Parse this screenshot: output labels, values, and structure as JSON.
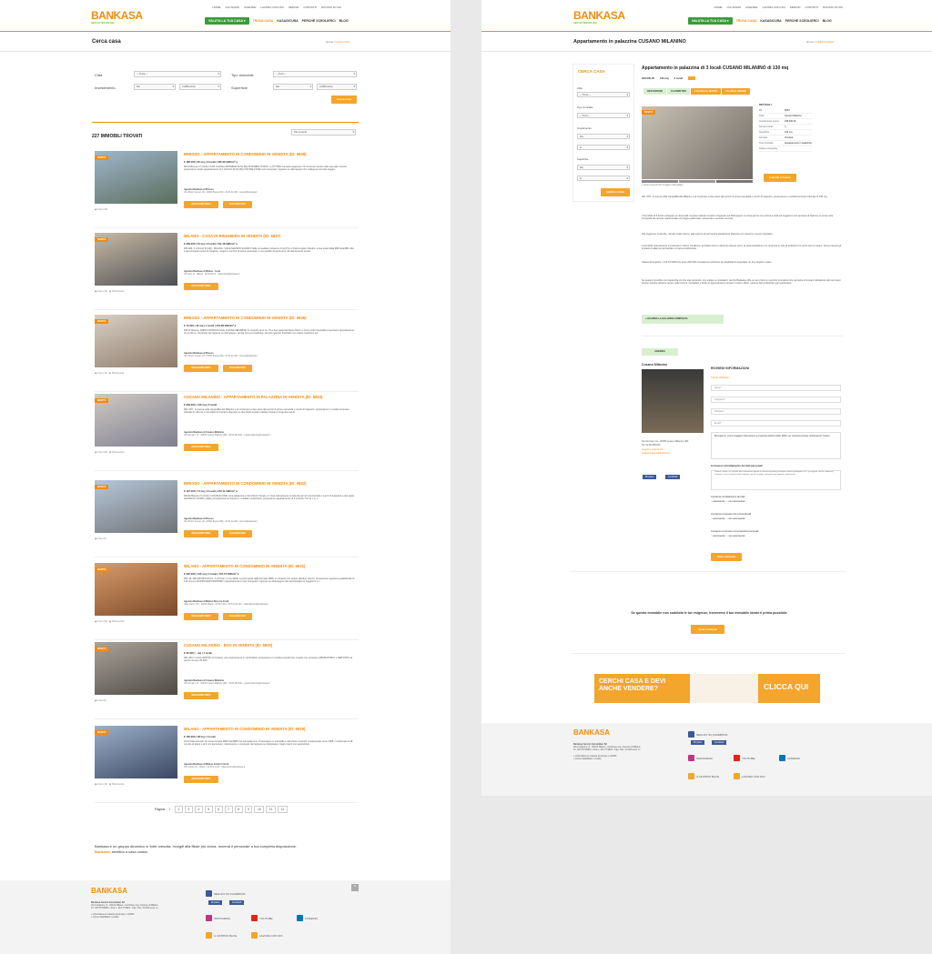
{
  "left": {
    "topnav": [
      "HOME",
      "CHI SIAMO",
      "AGENZIE",
      "LAVORA CON NOI",
      "SERVIZI",
      "CONTATTI",
      "DICONO DI NOI"
    ],
    "logo": {
      "text": "BANKASA",
      "sub": "SERVIZI IMMOBILIARI"
    },
    "mainnav": {
      "valuta": "VALUTA LA TUA CASA ▾",
      "trova": "TROVA CASA",
      "kasa": "KASASICURA",
      "perche": "PERCHÈ SCEGLIERCI",
      "blog": "BLOG"
    },
    "title": "Cerca casa",
    "breadcrumb": {
      "home": "Home",
      "sep": "/",
      "current": "Cerca casa"
    },
    "form": {
      "citta_label": "Città",
      "citta_value": "-- Tutte --",
      "tipo_label": "Tipo immobile",
      "tipo_value": "-- Tutti --",
      "inv_label": "Investimento",
      "inv_da": "Da",
      "inv_a": "indifferente",
      "sup_label": "Superficie",
      "sup_da": "Da",
      "sup_a": "indifferente",
      "button": "Cerca casa"
    },
    "count": "227 IMMOBILI TROVATI",
    "sort": "Più recenti",
    "badge": "NOVITÀ",
    "btn_info": "MAGGIORI INFO",
    "btn_kasa": "KASASICURA",
    "listings": [
      {
        "title": "BRESSO - APPARTAMENTO IN CONDOMINIO IN VENDITA (ID: 6838)",
        "meta": "€ 185.000 | 62 mq | 2 locali | 295,26 kWh/m² a",
        "desc": "Rif.24 Bresso 2 LOCALI CON CUCINA ABITABILE DI 62 MQ POSSIBILITÀ BOX. In OTTIMO contesto degli anni 70' circa ben tenuto nelle sue parti comuni, proponiamo ampio appartamento di 2 LOCALI DI 62 MQ CON BALCONE così composto: ingresso su disimpegno che collega al comodo soggio...",
        "agency": "Agenzia Bankasa di Bresso",
        "addr": "Via Vittorio Veneto, 29 - 20091 Bresso (MI) - 02.61.42.284 - bresso@bankasa.it",
        "foto": "Foto (13)",
        "kasa": true
      },
      {
        "title": "MILANO - CASA DI RINGHIERA IN VENDITA (ID: 6837)",
        "meta": "€ 269.000 | 54 mq | 2 locali | 511,48 kWh/m² a",
        "desc": "RIF.11B- 2 LOCALI 54 MQ - MILANO, VIALE MAZZINI SALMILT Nelle immediate vicinanze di via Prix e Piazza Appio Claudio, a due passi dalla MM Zara/MM Lilla e dai principali mezzi di trasporto, negozi e comfort di prima necessità, in uno stabile d'epoca anni '40 ottimamente tenuto.",
        "agency": "Agenzia Bankasa di Milano - Isola",
        "addr": "Via Lario 11 - Milano - 02.66.30.01 - milanoisola@bankasa.it",
        "foto": "Foto (14)",
        "plan": "Planimetria",
        "kasa": false
      },
      {
        "title": "BRESSO - APPARTAMENTO IN CONDOMINIO IN VENDITA (ID: 6836)",
        "meta": "€ 73.000 | 42 mq | 1 locali | 231,86 kWh/m² a",
        "desc": "RIF.57 Bresso, AMPIO MONOLOCALE CUCINA ABITABILE In contesto anni ca. 70 a due passi dal Parco Nord, in zona molto tranquilla proponiamo appartamento di mq 42 ca. composto da ingresso su disimpegno, ampia zona cucina/living, servizio igienico finestrato con vasca, locazione ed",
        "agency": "Agenzia Bankasa di Bresso",
        "addr": "Via Vittorio Veneto, 29 - 20091 Bresso (MI) - 02.61.42.284 - bresso@bankasa.it",
        "foto": "Foto (11)",
        "plan": "Planimetria",
        "kasa": true
      },
      {
        "title": "CUSANO MILANINO - APPARTAMENTO IN PALAZZINA IN VENDITA (ID: 6833)",
        "meta": "€ 239.000 | 130 mq | 3 locali",
        "desc": "RIF. 978 - Immersa nella tranquillità del Milanino e al contempo a due passi dai servizi di prima necessità e mezzi di trasporto, proponiamo in vendita luminoso trilocale di 130 mq. L'immobile di 3 locali è disposto su due livelli al piano rialzato troviamo l'ingresso sul di...",
        "agency": "Agenzia Bankasa di Cusano Milanino",
        "addr": "Via Sormani, 41 - 20095 Cusano Milanino (MI) - 02.66.409.610 - cusanomilanino@bankasa.it",
        "foto": "Foto (20)",
        "plan": "Planimetria",
        "kasa": false
      },
      {
        "title": "BRESSO - APPARTAMENTO IN CONDOMINIO IN VENDITA (ID: 6832)",
        "meta": "€ 127.000 | 74 mq | 3 locali | 270,11 kWh/m² a",
        "desc": "RIF.93 Bresso 3 LOCALI CON BALCONE zona adiacente a Via Vittorio Veneto, in zona ottimamente servita da servizi commerciali e mezzi di trasporto a due passi dal PARCO NORD e dalle principali linee di Autobus, in stabile condominio, proponiamo appartamento di 3 LOCALI 74 mq c.a. c",
        "agency": "Agenzia Bankasa di Bresso",
        "addr": "Via Vittorio Veneto, 29 - 20091 Bresso (MI) - 02.61.42.284 - bresso@bankasa.it",
        "foto": "Foto (9)",
        "kasa": true
      },
      {
        "title": "MILANO - APPARTAMENTO IN CONDOMINIO IN VENDITA (ID: 6831)",
        "meta": "€ 325.000 | 123 mq | 4 locali | 167,75 kWh/m² a",
        "desc": "RIF. 28, MILANO BICOCCA, 4 LOCALI. In via Sidoli, a pochi passi dalla fermata MM5, in contesto con ampio giardino interno, proponiamo spazioso quadrilocale di 123 mq con DOPPIA ESPOSIZIONE! L'appartamento è così composto: ingresso su disimpegno che accompagna in soggiorno e c",
        "agency": "Agenzia Bankasa di Milano Bicocca Fredi",
        "addr": "Viale Sarca, 161 - 20126 Milano - 02.64.744.0 / 02.64.744.120 - milanobicocca@bankasa.it",
        "foto": "Foto (20)",
        "plan": "Planimetria",
        "kasa": true
      },
      {
        "title": "CUSANO MILANINO - BOX IN VENDITA (ID: 6830)",
        "meta": "€ 35.000 | - mq | 1 locali",
        "desc": "RIF. 831 In zona CENTRO di Cusano, più precisamente in via Pedretti, proponiamo in vendita comodo box singolo con annesso LABORATORIO e DEPOSITO al prezzo di euro 35.000!",
        "agency": "Agenzia Bankasa di Cusano Milanino",
        "addr": "Via Sormani, 41 - 20095 Cusano Milanino (MI) - 02.66.409.610 - cusanomilanino@bankasa.it",
        "foto": "Foto (8)",
        "kasa": false
      },
      {
        "title": "MILANO - APPARTAMENTO IN CONDOMINIO IN VENDITA (ID: 6829)",
        "meta": "€ 195.000 | 38 mq | 1 locali",
        "desc": "Via Privata Cenisio 10, Zona Cenisio MM5 Via/MM5 Via Gerusalemme, Proponiamo in tranquillo e silenzioso contesto condominiale anno 2005, monolocale di 38 mq sito al piano 1 di 4 con ascensore. Interamente e composto da ingresso su disimpegno, bagno cieco con aspirazione",
        "agency": "Agenzia Bankasa di Milano Centro Fiorini",
        "addr": "Via Cenisio 10 - Milano - 02.33.14.123 - milanocentro@bankasa.it",
        "foto": "Foto (10)",
        "plan": "Planimetria",
        "kasa": false
      }
    ],
    "pager": {
      "label": "Pagina",
      "pages": [
        "1",
        "2",
        "3",
        "4",
        "5",
        "6",
        "7",
        "8",
        "9",
        "10",
        "11",
        "12"
      ]
    },
    "promo": {
      "text": "Bankasa è un gruppo dinamico in forte crescita, rivolgiti alla filiale più vicina, troverai il personale a tua completa disposizione.",
      "line2a": "Bankasa:",
      "line2b": "sentiti/a a casa vostra."
    },
    "footer": {
      "company": "Bankasa Servizi Immobiliari Srl",
      "addr": "Via Curtatone, 8 - 20122 Milano - Iscrizione reg. imprese di Milano",
      "piva": "P.I. 04775700960 - Rea n. 06 1771823 - Cap. Soc. 10.000 euro i.v.",
      "privacy": "» Informativa in materia di privacy e GDPR",
      "cookie": "» Come disabilitare i cookie",
      "facebook": "SEGUICI SU FACEBOOK",
      "like": "Mi piace",
      "share": "Condividi",
      "instagram": "INSTAGRAM",
      "youtube": "YOUTUBE",
      "linkedin": "LINKEDIN",
      "blog": "IL NOSTRO BLOG",
      "lavora": "LAVORA CON NOI"
    }
  },
  "right": {
    "title": "Appartamento in palazzina CUSANO MILANINO",
    "breadcrumb": {
      "home": "Home",
      "sep": "/",
      "current": "CERCA CASA"
    },
    "sidebar": {
      "title": "CERCA CASA",
      "citta": "Città",
      "citta_val": "-- Tutte --",
      "tipo": "Tipo immobile",
      "tipo_val": "-- Tutti --",
      "inv": "Investimento",
      "inv_da": "Da",
      "inv_a": "A",
      "sup": "Superficie",
      "sup_da": "Da",
      "sup_a": "A",
      "button": "CERCA CASA"
    },
    "heading": "Appartamento in palazzina di 3 locali CUSANO MILANINO di 130 mq",
    "meta": [
      "239.000,00",
      "130 mq",
      "3 locali"
    ],
    "tabs": [
      "DESCRIZIONE",
      "PLANIMETRIA",
      "CALCOLA IL MUTUO",
      "VALUTA IL SOGNO"
    ],
    "gallery_note": "» Sono presenti 20 immagini nella gallery",
    "details": {
      "title": "DETTAGLI",
      "rows": [
        [
          "Rif.",
          "6833"
        ],
        [
          "Città",
          "Cusano Milanino"
        ],
        [
          "Investimento (euro)",
          "239.000,00"
        ],
        [
          "Numero locali",
          "3"
        ],
        [
          "Superficie",
          "130 mq"
        ],
        [
          "Comune",
          "Venduta"
        ],
        [
          "Tipo immobile",
          "Appartamento in palazzina"
        ],
        [
          "Classe energetica",
          ""
        ]
      ]
    },
    "calc_button": "Calcola il mutuo",
    "desc1": "RIF. 978 - Immersa nella tranquillità del Milanino e al contempo a due passi dai servizi di prima necessità e mezzi di trasporto, proponiamo in vendita luminoso trilocale di 130 mq.",
    "desc2": "L'immobile di 3 locali è disposto su due livelli: al piano rialzato troviamo l'ingresso sul disimpegno, la zona giorno con cucina a vista sul soggiorno con accesso al balcone, la zona notte composta da camera matrimoniale con bagno padronale, cameretta e secondo servizio.",
    "desc3": "Dal soggiorno si accede, tramite scala interna, alla taverna di pertinenza attualmente disposta con camera e ampio ripostiglio.",
    "desc4": "L'immobile internamente si presenta in ottime condizioni, gli infissi sono in alluminio doppio vetro, la pavimentazione è in ceramica in tutti gli ambienti e le porte sono in legno. Sono presenti gli impianti di allarme perimetrale e di aria condizionata.",
    "desc5": "Classe Energetica = 116,73 kWh/m²a. Euro 239.000 Completa la soluzione la possibilità di acquistare un box singolo a parte.",
    "desc6": "Se questo immobile non rispecchia ciò che stai cercando, non esitare a contattarci: perché Bankasa offre ai suoi clienti un servizio innovativo che permette di trovare l'abitazione dei tuoi sogni senza investire ulteriore tempo nella ricerca. Contattaci e fissa un appuntamento presso il nostro ufficio, saremo lieti di illustrarti ogni particolare.",
    "gallery_btn": "» GUARDA LA GALLERIA COMPLETA",
    "agency_tab": "AGENZIA",
    "agency_name": "Cusano Milanino",
    "agency_addr": "Via Sormani, 41 - 20095 Cusano Milanino (MI)",
    "agency_tel": "Tel. 02.66.409.610",
    "agency_fb": "Seguici su Facebook",
    "agency_mail": "cusanomilanino@bankasa.it",
    "form": {
      "title": "RICHIEDI INFORMAZIONI",
      "required": "*Campi obbligatori",
      "nome": "Nome*",
      "cognome": "Cognome*",
      "telefono": "Telefono*",
      "email": "Email*",
      "message": "Buongiorno, vorrei maggiori informazioni a proposito dell'immobile 6833, per cortesia potreste richiamarmi? Grazie",
      "consent_title": "Consenso al trattamento dei dati personali",
      "consent_text": "Gentile Cliente, nel rispetto della normativa vigente in materia di privacy, Bankasa Servizi Immobiliari S.r.l. (di seguito, anche 'Bankasa') comunica che in relazione del contratto, nel fine di poter instaurare dei rapporti commerciali...",
      "c1": "Consenso al trattamento dei dati",
      "c2": "Consenso a ricevere info promozionali",
      "c3": "Consenso a ricevere comunicazioni personali",
      "yes": "acconsento",
      "no": "non acconsento",
      "submit": "Invia richiesta"
    },
    "cta_text": "Se questo immobile non soddisfa le tue esigenze, troveremo il tuo immobile ideale il prima possibile",
    "cta_button": "Invia richiesta",
    "banner": {
      "line1": "CERCHI CASA E DEVI",
      "line2": "ANCHE VENDERE?",
      "cta": "CLICCA QUI"
    }
  }
}
